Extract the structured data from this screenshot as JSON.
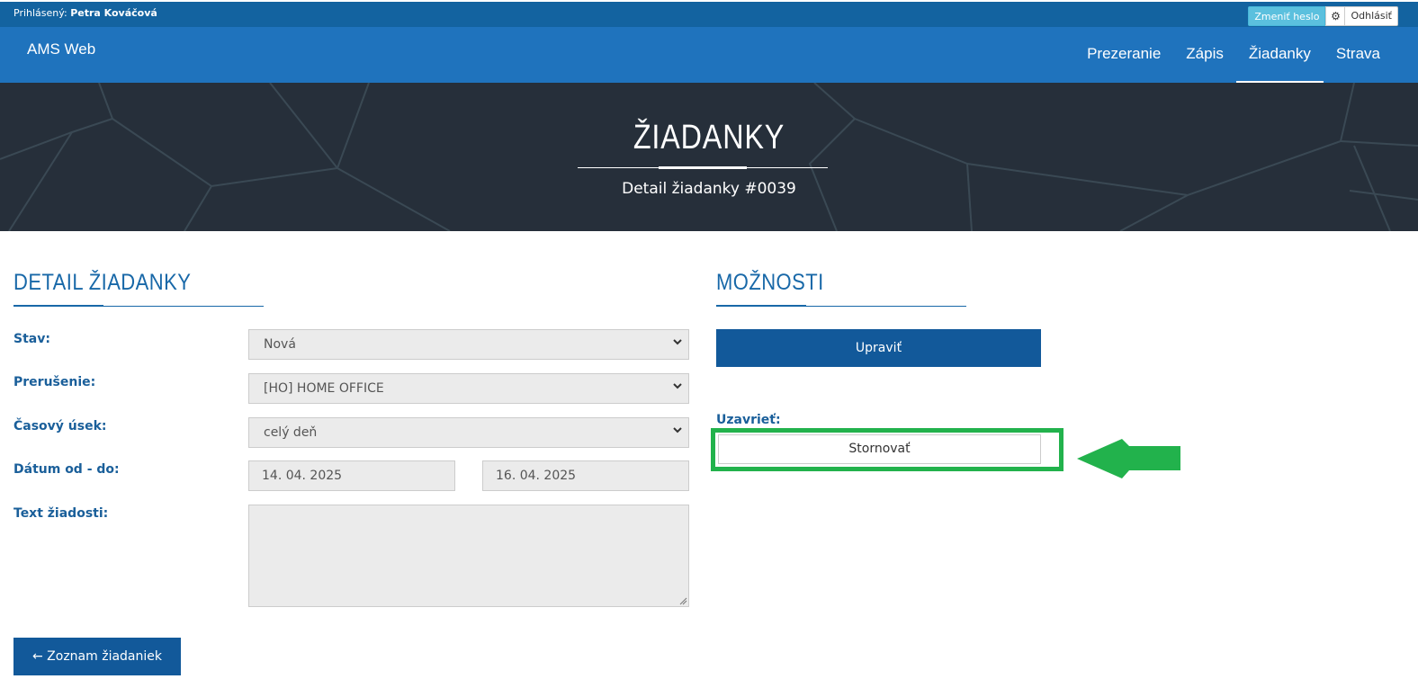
{
  "topbar": {
    "user_prefix": "Prihlásený:",
    "user_name": "Petra Kováčová",
    "change_password": "Zmeniť heslo",
    "settings_icon": "gear-icon",
    "logout": "Odhlásiť"
  },
  "navbar": {
    "brand": "AMS Web",
    "items": [
      {
        "label": "Prezeranie"
      },
      {
        "label": "Zápis"
      },
      {
        "label": "Žiadanky",
        "active": true
      },
      {
        "label": "Strava"
      }
    ]
  },
  "hero": {
    "title": "ŽIADANKY",
    "subtitle": "Detail žiadanky #0039"
  },
  "detail": {
    "title": "DETAIL ŽIADANKY",
    "stav_label": "Stav:",
    "stav_value": "Nová",
    "prerusenie_label": "Prerušenie:",
    "prerusenie_value": "[HO] HOME OFFICE",
    "casovy_usek_label": "Časový úsek:",
    "casovy_usek_value": "celý deň",
    "datum_label": "Dátum od - do:",
    "datum_od": "14. 04. 2025",
    "datum_do": "16. 04. 2025",
    "text_label": "Text žiadosti:",
    "text_value": "",
    "back_button": "← Zoznam žiadaniek"
  },
  "options": {
    "title": "MOŽNOSTI",
    "edit_button": "Upraviť",
    "close_label": "Uzavrieť:",
    "cancel_button": "Stornovať"
  },
  "colors": {
    "topbar": "#1363a0",
    "navbar": "#1f73bd",
    "accent": "#12599a",
    "highlight": "#22b24c"
  }
}
